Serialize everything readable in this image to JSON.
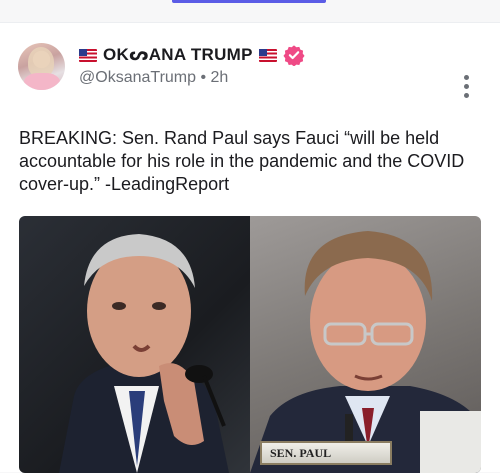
{
  "post": {
    "author": {
      "display_name": "OKᔕANA TRUMP",
      "handle": "@OksanaTrump",
      "separator": "•",
      "time": "2h",
      "verified": true
    },
    "text": "BREAKING: Sen. Rand Paul says Fauci “will be held accountable for his role in the pandemic and the COVID cover-up.” -LeadingReport",
    "media": {
      "nameplate": "SEN. PAUL"
    }
  },
  "icons": {
    "flag": "us-flag-icon",
    "verified": "verified-badge-icon",
    "more": "more-vertical-icon"
  },
  "colors": {
    "tab_indicator": "#5b5ce6",
    "verified_badge": "#ef4a86",
    "text": "#1b1b1f",
    "muted": "#6b6f76"
  }
}
